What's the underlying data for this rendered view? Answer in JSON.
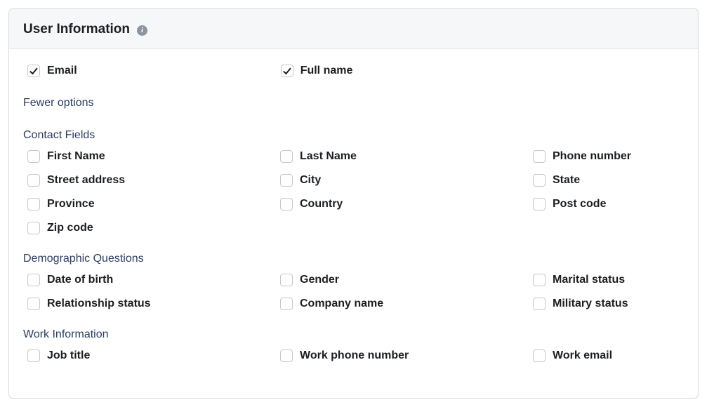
{
  "card": {
    "title": "User Information",
    "info_glyph": "i"
  },
  "top": {
    "email": {
      "label": "Email",
      "checked": true
    },
    "full_name": {
      "label": "Full name",
      "checked": true
    }
  },
  "toggle": {
    "label": "Fewer options"
  },
  "sections": {
    "contact": {
      "title": "Contact Fields",
      "fields": [
        "First Name",
        "Last Name",
        "Phone number",
        "Street address",
        "City",
        "State",
        "Province",
        "Country",
        "Post code",
        "Zip code"
      ]
    },
    "demographic": {
      "title": "Demographic Questions",
      "fields": [
        "Date of birth",
        "Gender",
        "Marital status",
        "Relationship status",
        "Company name",
        "Military status"
      ]
    },
    "work": {
      "title": "Work Information",
      "fields": [
        "Job title",
        "Work phone number",
        "Work email"
      ]
    }
  }
}
